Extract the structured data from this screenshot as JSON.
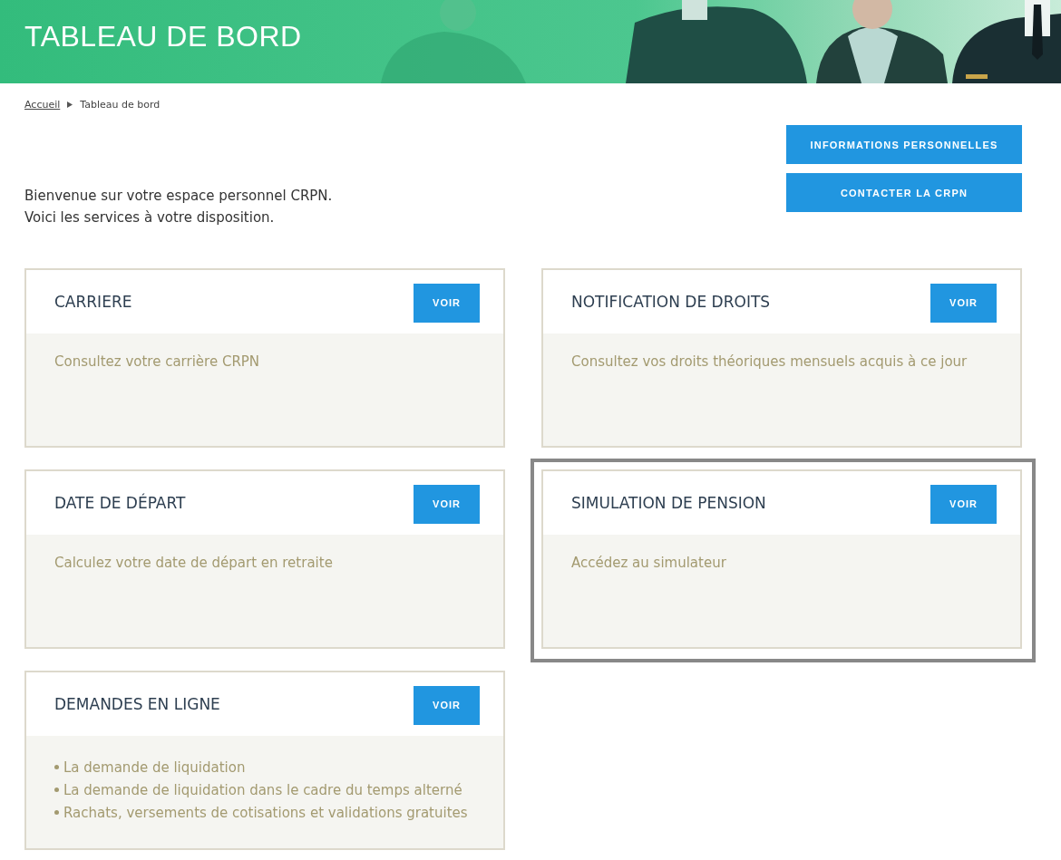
{
  "header": {
    "title": "TABLEAU DE BORD",
    "kind": "picture"
  },
  "breadcrumb": [
    {
      "label": "Accueil",
      "link": true
    },
    {
      "label": "Tableau de bord",
      "link": false
    }
  ],
  "actions": [
    "INFORMATIONS PERSONNELLES",
    "CONTACTER LA CRPN"
  ],
  "welcome": [
    "Bienvenue sur votre espace personnel CRPN.",
    "Voici les services à votre disposition."
  ],
  "cards": [
    {
      "title": "CARRIERE",
      "button": "VOIR",
      "highlighted": false,
      "text": "Consultez votre carrière CRPN"
    },
    {
      "title": "NOTIFICATION DE DROITS",
      "button": "VOIR",
      "highlighted": false,
      "text": "Consultez vos droits théoriques mensuels acquis à ce jour"
    },
    {
      "title": "DATE DE DÉPART",
      "button": "VOIR",
      "highlighted": false,
      "text": "Calculez votre date de départ en retraite"
    },
    {
      "title": "SIMULATION DE PENSION",
      "button": "VOIR",
      "highlighted": true,
      "text": "Accédez au simulateur"
    },
    {
      "title": "DEMANDES EN LIGNE",
      "button": "VOIR",
      "highlighted": false,
      "items": [
        "La demande de liquidation",
        "La demande de liquidation dans le cadre du temps alterné",
        "Rachats, versements de cotisations et validations gratuites"
      ]
    }
  ]
}
